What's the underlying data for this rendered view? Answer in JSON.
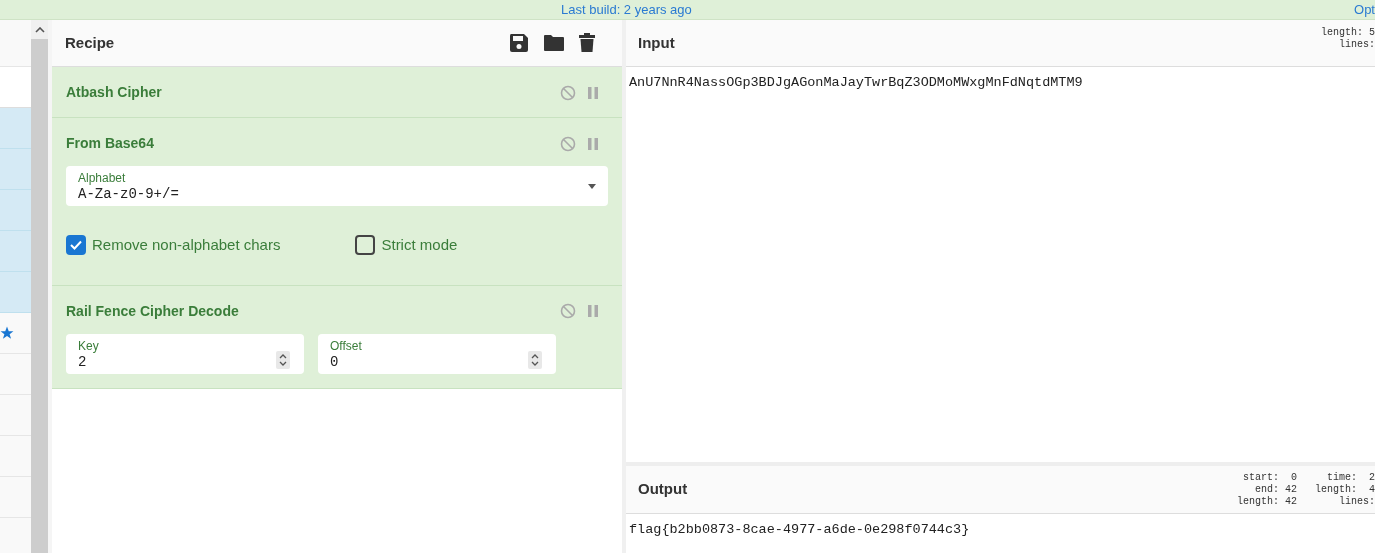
{
  "top_bar": {
    "build": "Last build: 2 years ago",
    "options_link": "Opt"
  },
  "operations_list": {
    "rows": [
      {
        "kind": "header",
        "highlighted": false
      },
      {
        "kind": "search",
        "highlighted": false
      },
      {
        "kind": "plain",
        "highlighted": true
      },
      {
        "kind": "plain",
        "highlighted": true
      },
      {
        "kind": "plain",
        "highlighted": true
      },
      {
        "kind": "plain",
        "highlighted": true
      },
      {
        "kind": "plain",
        "highlighted": true
      },
      {
        "kind": "star",
        "highlighted": false
      },
      {
        "kind": "plain",
        "highlighted": false
      },
      {
        "kind": "plain",
        "highlighted": false
      },
      {
        "kind": "plain",
        "highlighted": false
      },
      {
        "kind": "plain",
        "highlighted": false
      },
      {
        "kind": "plain",
        "highlighted": false
      }
    ]
  },
  "recipe": {
    "title": "Recipe",
    "operations": [
      {
        "name": "Atbash Cipher"
      },
      {
        "name": "From Base64",
        "args": [
          {
            "kind": "dropdown",
            "label": "Alphabet",
            "value": "A-Za-z0-9+/="
          },
          {
            "kind": "checkbox",
            "label": "Remove non-alphabet chars",
            "checked": true
          },
          {
            "kind": "checkbox",
            "label": "Strict mode",
            "checked": false
          }
        ]
      },
      {
        "name": "Rail Fence Cipher Decode",
        "args": [
          {
            "kind": "number",
            "label": "Key",
            "value": "2"
          },
          {
            "kind": "number",
            "label": "Offset",
            "value": "0"
          }
        ]
      }
    ]
  },
  "input": {
    "title": "Input",
    "text": "AnU7NnR4NassOGp3BDJgAGonMaJayTwrBqZ3ODMoMWxgMnFdNqtdMTM9",
    "stats": [
      "length: 5",
      "lines:"
    ]
  },
  "output": {
    "title": "Output",
    "text": "flag{b2bb0873-8cae-4977-a6de-0e298f0744c3}",
    "stats_left": [
      "start:  0",
      "end: 42",
      "length: 42"
    ],
    "stats_right": [
      "time:  2",
      "length:  4",
      "lines:"
    ]
  }
}
